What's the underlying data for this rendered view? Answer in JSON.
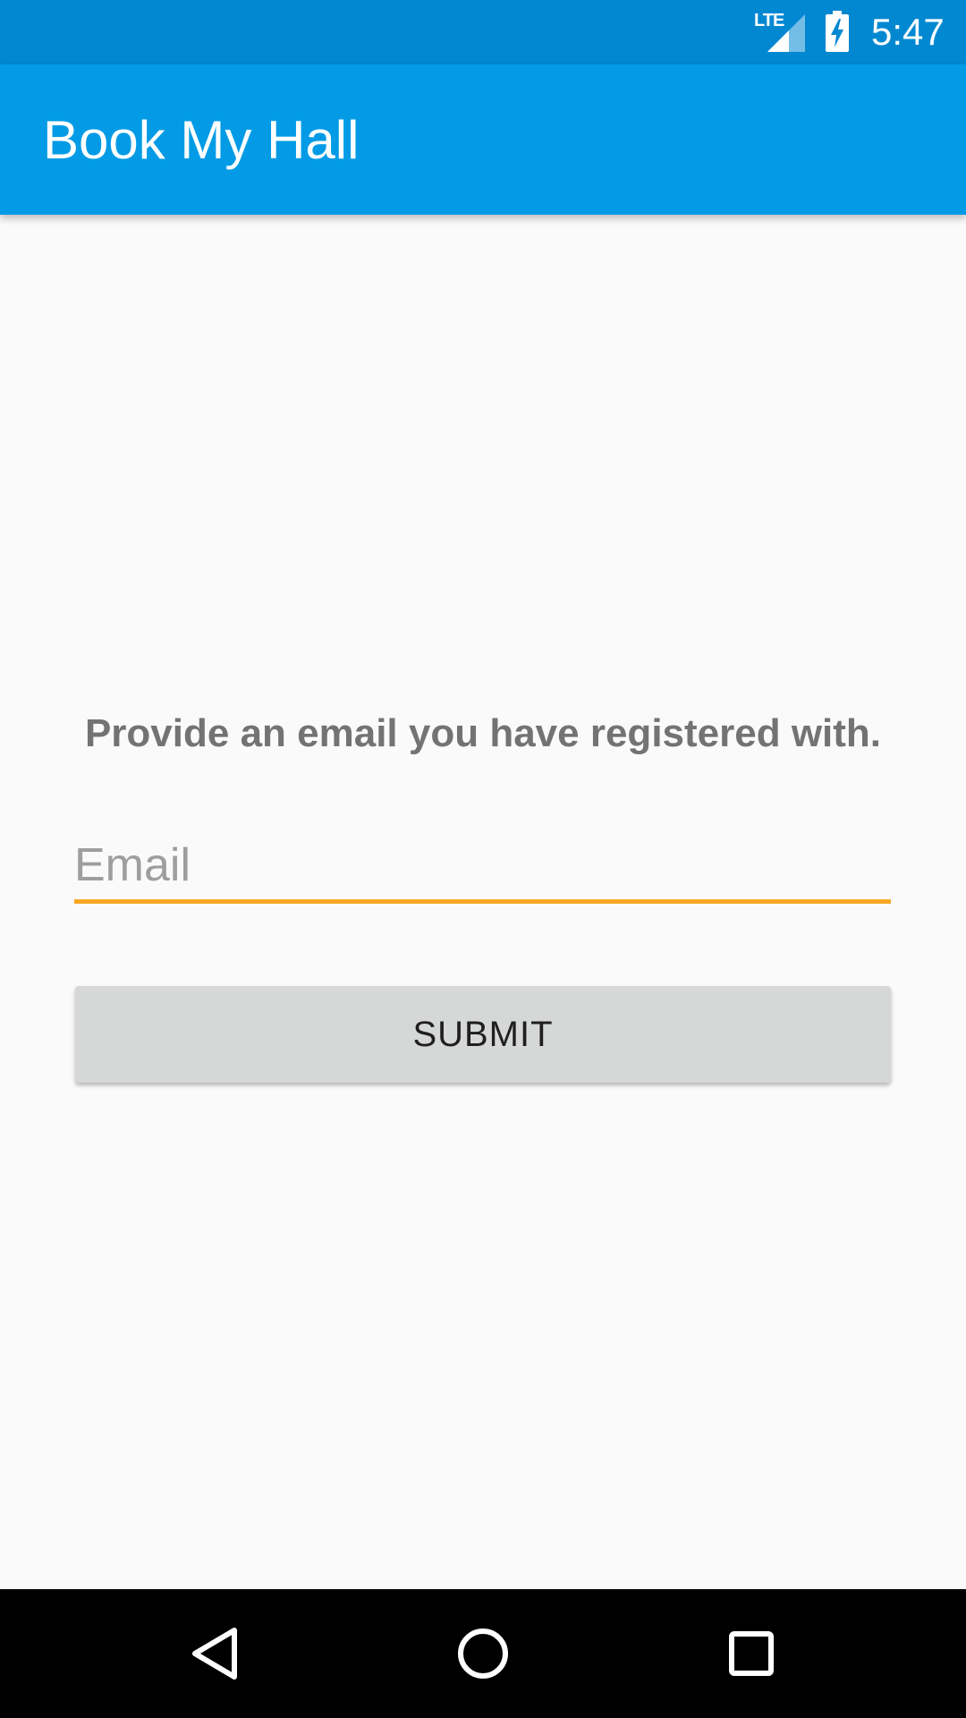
{
  "status_bar": {
    "network_label": "LTE",
    "time": "5:47",
    "icons": [
      "lte-signal-icon",
      "battery-charging-icon"
    ]
  },
  "app_bar": {
    "title": "Book My Hall"
  },
  "form": {
    "prompt": "Provide an email you have registered with.",
    "email_placeholder": "Email",
    "email_value": "",
    "submit_label": "SUBMIT"
  },
  "nav_bar": {
    "icons": [
      "back-icon",
      "home-icon",
      "recents-icon"
    ]
  },
  "colors": {
    "status_bar": "#0288d1",
    "app_bar": "#039be5",
    "background": "#fafafa",
    "field_underline": "#f9a825",
    "button": "#d6d7d7",
    "prompt_text": "#737373"
  }
}
